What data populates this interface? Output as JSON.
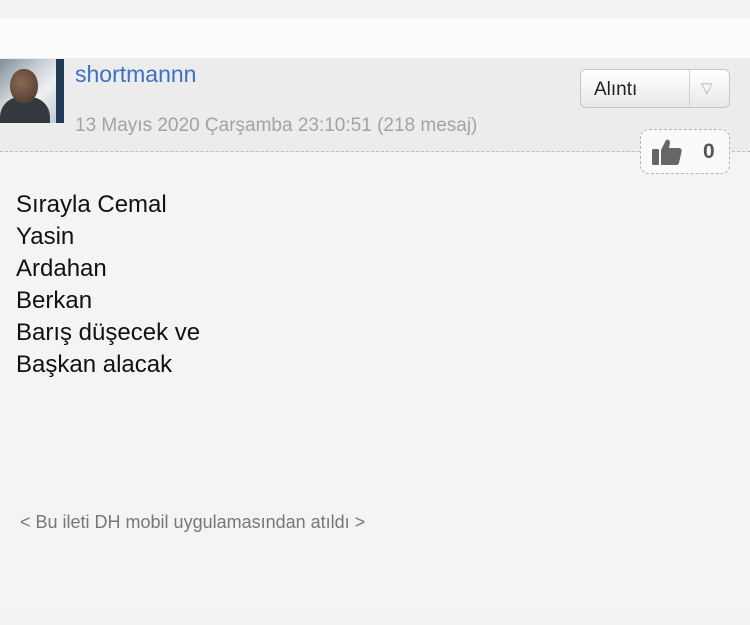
{
  "post": {
    "username": "shortmannn",
    "meta": "13 Mayıs 2020 Çarşamba 23:10:51 (218 mesaj)",
    "quote_button": {
      "label": "Alıntı",
      "dropdown_icon": "▽"
    },
    "like": {
      "icon": "thumbs-up-icon",
      "count": "0"
    },
    "message_lines": [
      "Sırayla Cemal",
      "Yasin",
      "Ardahan",
      "Berkan",
      "Barış düşecek ve",
      "Başkan alacak"
    ],
    "footer_note": "< Bu ileti DH mobil uygulamasından atıldı >"
  },
  "colors": {
    "username": "#3c6fc8",
    "meta": "#a3a3a3",
    "background": "#f4f4f4",
    "header_background": "#ececec"
  }
}
